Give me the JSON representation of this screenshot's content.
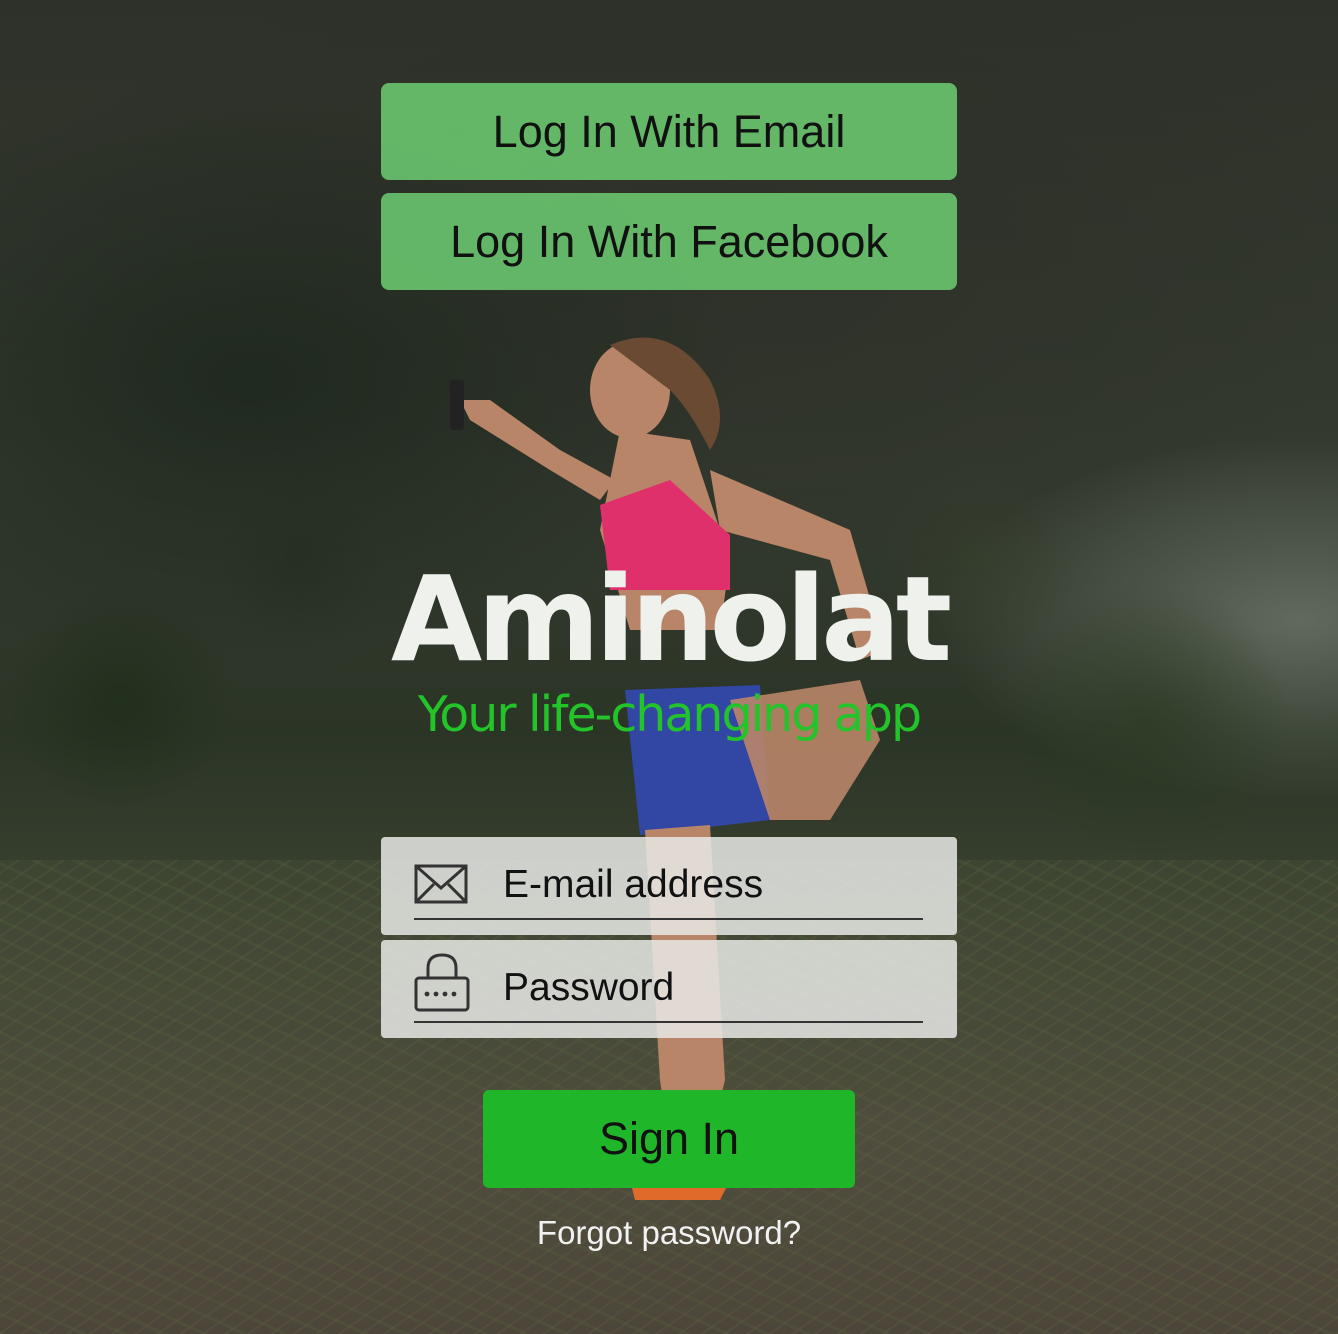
{
  "buttons": {
    "email_login": "Log In With Email",
    "facebook_login": "Log In With Facebook",
    "sign_in": "Sign In"
  },
  "brand": {
    "logo": "Aminolat",
    "tagline": "Your life-changing app",
    "accent_color": "#22c42a"
  },
  "form": {
    "email_placeholder": "E-mail address",
    "password_placeholder": "Password",
    "email_icon": "envelope-icon",
    "password_icon": "lock-icon"
  },
  "links": {
    "forgot_password": "Forgot password?"
  }
}
